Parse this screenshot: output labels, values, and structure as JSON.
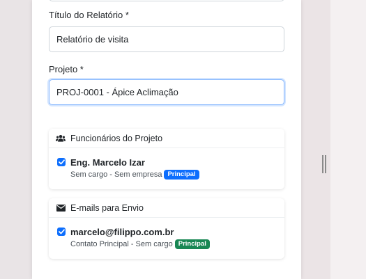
{
  "form": {
    "title_label": "Título do Relatório *",
    "title_value": "Relatório de visita",
    "project_label": "Projeto *",
    "project_value": "PROJ-0001 - Ápice Aclimação"
  },
  "employees_card": {
    "header": "Funcionários do Projeto",
    "icon": "users-icon",
    "items": [
      {
        "name": "Eng. Marcelo Izar",
        "subtitle": "Sem cargo - Sem empresa",
        "badge": "Principal",
        "checked": true
      }
    ]
  },
  "emails_card": {
    "header": "E-mails para Envio",
    "icon": "envelope-icon",
    "items": [
      {
        "name": "marcelo@filippo.com.br",
        "subtitle": "Contato Principal - Sem cargo",
        "badge": "Principal",
        "checked": true
      }
    ]
  },
  "colors": {
    "primary": "#0d6efd",
    "success": "#198754",
    "focus_border": "#86b7fe"
  }
}
